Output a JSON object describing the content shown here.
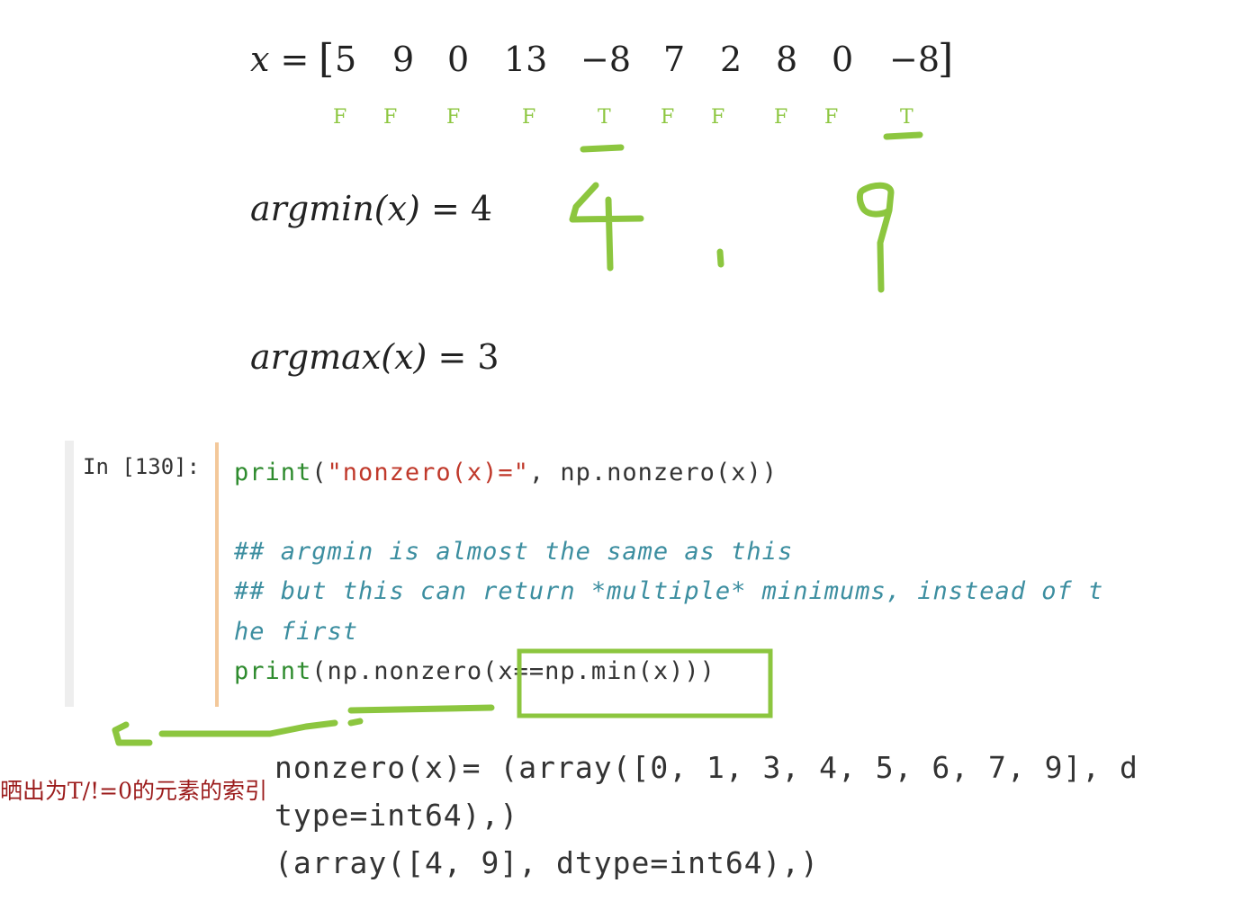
{
  "formula_x": {
    "lhs": "x =",
    "open": "[",
    "close": "]",
    "values": [
      "5",
      "9",
      "0",
      "13",
      "−8",
      "7",
      "2",
      "8",
      "0",
      "−8"
    ],
    "flags": [
      "F",
      "F",
      "F",
      "F",
      "T",
      "F",
      "F",
      "F",
      "F",
      "T"
    ]
  },
  "argmin_line": {
    "fn": "argmin(x)",
    "eq": "= 4"
  },
  "argmax_line": {
    "fn": "argmax(x)",
    "eq": "= 3"
  },
  "cell": {
    "prompt": "In [130]:",
    "line1_kw": "print",
    "line1_p1": "(",
    "line1_str": "\"nonzero(x)=\"",
    "line1_rest": ", np.nonzero(x))",
    "comment1": "## argmin is almost the same as this",
    "comment2": "## but this can return *multiple* minimums, instead of t",
    "comment3": "he first",
    "line5_kw": "print",
    "line5_rest": "(np.nonzero(x==np.min(x)))"
  },
  "output": {
    "line1": "nonzero(x)= (array([0, 1, 3, 4, 5, 6, 7, 9], d",
    "line2": "type=int64),)",
    "line3": "(array([4, 9], dtype=int64),)"
  },
  "annotation_text": "晒出为T/!=0的元素的索引",
  "colors": {
    "ink": "#8cc63f",
    "annotation": "#9b1b1b",
    "cell_border": "#f3c89a"
  }
}
